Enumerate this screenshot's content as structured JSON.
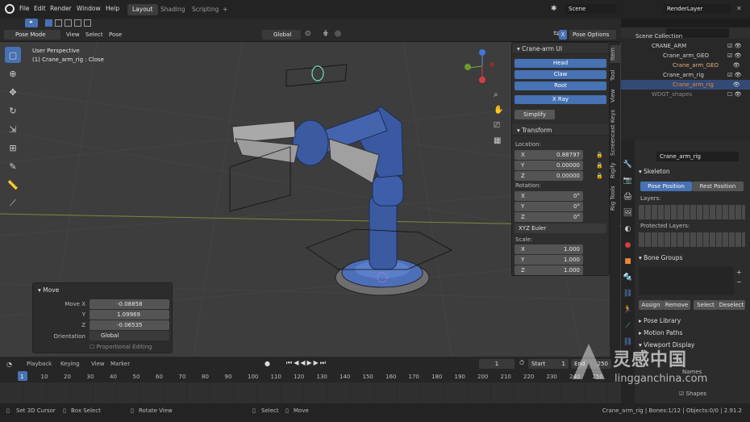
{
  "topbar": {
    "menus": [
      "File",
      "Edit",
      "Render",
      "Window",
      "Help"
    ],
    "workspaces": [
      "Layout",
      "Shading",
      "Scripting"
    ],
    "add_tab": "+",
    "scene_label": "Scene",
    "renderlayer_label": "RenderLayer"
  },
  "header": {
    "mode": "Pose Mode",
    "menus": [
      "View",
      "Select",
      "Pose"
    ],
    "orientation": "Global",
    "pose_options": "Pose Options",
    "x_mirror": "X"
  },
  "viewport": {
    "title": "User Perspective",
    "subtitle": "(1) Crane_arm_rig : Close"
  },
  "npanel": {
    "crane_ui_title": "Crane-arm UI",
    "buttons": [
      "Head",
      "Claw",
      "Root",
      "X Ray"
    ],
    "simplify": "Simplify",
    "transform_title": "Transform",
    "location_label": "Location:",
    "location": [
      {
        "axis": "X",
        "value": "0.88797"
      },
      {
        "axis": "Y",
        "value": "0.00000"
      },
      {
        "axis": "Z",
        "value": "0.00000"
      }
    ],
    "rotation_label": "Rotation:",
    "rotation": [
      {
        "axis": "X",
        "value": "0°"
      },
      {
        "axis": "Y",
        "value": "0°"
      },
      {
        "axis": "Z",
        "value": "0°"
      }
    ],
    "rotation_mode": "XYZ Euler",
    "scale_label": "Scale:",
    "scale": [
      {
        "axis": "X",
        "value": "1.000"
      },
      {
        "axis": "Y",
        "value": "1.000"
      },
      {
        "axis": "Z",
        "value": "1.000"
      }
    ]
  },
  "vtabs": [
    "Item",
    "Tool",
    "View",
    "Screencast Keys",
    "Rigify",
    "Rig Tools"
  ],
  "outliner": {
    "rows": [
      "Scene Collection",
      "CRANE_ARM",
      "Crane_arm_GEO",
      "Crane_arm_GEO",
      "Crane_arm_rig",
      "Crane_arm_rig",
      "WDGT_shapes"
    ]
  },
  "properties": {
    "search_value": "Crane_arm_rig",
    "skeleton": "Skeleton",
    "pose_position": "Pose Position",
    "rest_position": "Rest Position",
    "layers": "Layers:",
    "protected_layers": "Protected Layers:",
    "bone_groups": "Bone Groups",
    "bg_buttons": [
      "Assign",
      "Remove",
      "Select",
      "Deselect"
    ],
    "more_sections": [
      "Pose Library",
      "Motion Paths",
      "Viewport Display"
    ],
    "names": "Names",
    "shapes": "Shapes"
  },
  "move_panel": {
    "title": "Move",
    "rows": [
      {
        "label": "Move X",
        "value": "-0.08858"
      },
      {
        "label": "Y",
        "value": "1.09969"
      },
      {
        "label": "Z",
        "value": "-0.06535"
      }
    ],
    "orientation_label": "Orientation",
    "orientation_value": "Global",
    "proportional": "Proportional Editing"
  },
  "timeline": {
    "menus": [
      "Playback",
      "Keying",
      "View",
      "Marker"
    ],
    "current_frame": "1",
    "start_label": "Start",
    "start_value": "1",
    "end_label": "End",
    "end_value": "250",
    "ticks": [
      "1",
      "10",
      "20",
      "30",
      "40",
      "50",
      "60",
      "70",
      "80",
      "90",
      "100",
      "110",
      "120",
      "130",
      "140",
      "150",
      "160",
      "170",
      "180",
      "190",
      "200",
      "210",
      "220",
      "230",
      "240",
      "250"
    ]
  },
  "statusbar": {
    "items": [
      "Set 3D Cursor",
      "Box Select",
      "Rotate View",
      "Select",
      "Move"
    ],
    "right": "Crane_arm_rig | Bones:1/12 | Objects:0/0 | 2.91.2"
  },
  "watermark": {
    "cn": "灵感中国",
    "url": "lingganchina.com"
  },
  "colors": {
    "accent": "#4772b3",
    "viewport_bg": "#3d3d3d",
    "panel_bg": "#2e2e2e",
    "arm_blue": "#3b5aa0",
    "rig_orange": "#e9893a"
  }
}
